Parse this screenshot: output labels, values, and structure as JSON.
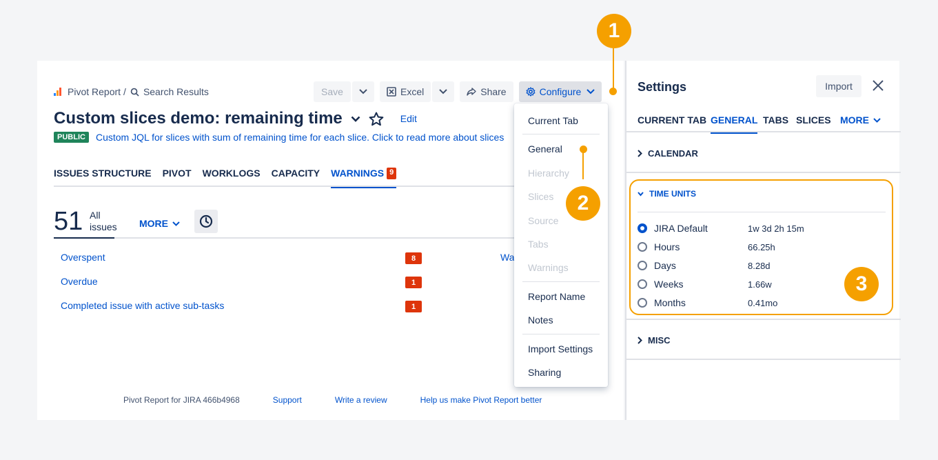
{
  "breadcrumb": {
    "app": "Pivot Report",
    "separator": "/",
    "search": "Search Results"
  },
  "toolbar": {
    "save": "Save",
    "excel": "Excel",
    "share": "Share",
    "configure": "Configure"
  },
  "report": {
    "title": "Custom slices demo: remaining time",
    "edit": "Edit",
    "badge": "PUBLIC",
    "description": "Custom JQL for slices with sum of remaining time for each slice. Click to read more about slices"
  },
  "tabs": [
    {
      "label": "ISSUES STRUCTURE"
    },
    {
      "label": "PIVOT"
    },
    {
      "label": "WORKLOGS"
    },
    {
      "label": "CAPACITY"
    },
    {
      "label": "WARNINGS",
      "badge": "9",
      "active": true
    }
  ],
  "counter": {
    "value": "51",
    "label_line1": "All",
    "label_line2": "issues",
    "more": "MORE"
  },
  "warnings": [
    {
      "label": "Overspent",
      "count": "8",
      "extra": "Wa"
    },
    {
      "label": "Overdue",
      "count": "1"
    },
    {
      "label": "Completed issue with active sub-tasks",
      "count": "1"
    }
  ],
  "footer": {
    "version": "Pivot Report for JIRA 466b4968",
    "support": "Support",
    "review": "Write a review",
    "help": "Help us make Pivot Report better"
  },
  "menu": {
    "items": [
      {
        "label": "Current Tab",
        "disabled": false
      },
      {
        "label": "General",
        "disabled": false
      },
      {
        "label": "Hierarchy",
        "disabled": true
      },
      {
        "label": "Slices",
        "disabled": true
      },
      {
        "label": "Source",
        "disabled": true
      },
      {
        "label": "Tabs",
        "disabled": true
      },
      {
        "label": "Warnings",
        "disabled": true
      },
      {
        "label": "Report Name",
        "disabled": false
      },
      {
        "label": "Notes",
        "disabled": false
      },
      {
        "label": "Import Settings",
        "disabled": false
      },
      {
        "label": "Sharing",
        "disabled": false
      }
    ]
  },
  "settings": {
    "title": "Settings",
    "import": "Import",
    "tabs": [
      "CURRENT TAB",
      "GENERAL",
      "TABS",
      "SLICES"
    ],
    "more": "MORE",
    "active_tab": "GENERAL",
    "sections": {
      "calendar": "CALENDAR",
      "time_units": "TIME UNITS",
      "misc": "MISC"
    },
    "time_units": [
      {
        "label": "JIRA Default",
        "value": "1w 3d 2h 15m",
        "checked": true
      },
      {
        "label": "Hours",
        "value": "66.25h",
        "checked": false
      },
      {
        "label": "Days",
        "value": "8.28d",
        "checked": false
      },
      {
        "label": "Weeks",
        "value": "1.66w",
        "checked": false
      },
      {
        "label": "Months",
        "value": "0.41mo",
        "checked": false
      }
    ]
  },
  "annotations": {
    "one": "1",
    "two": "2",
    "three": "3"
  },
  "colors": {
    "accent": "#0052cc",
    "callout": "#f5a000",
    "danger": "#de350b",
    "public": "#1f845a"
  }
}
